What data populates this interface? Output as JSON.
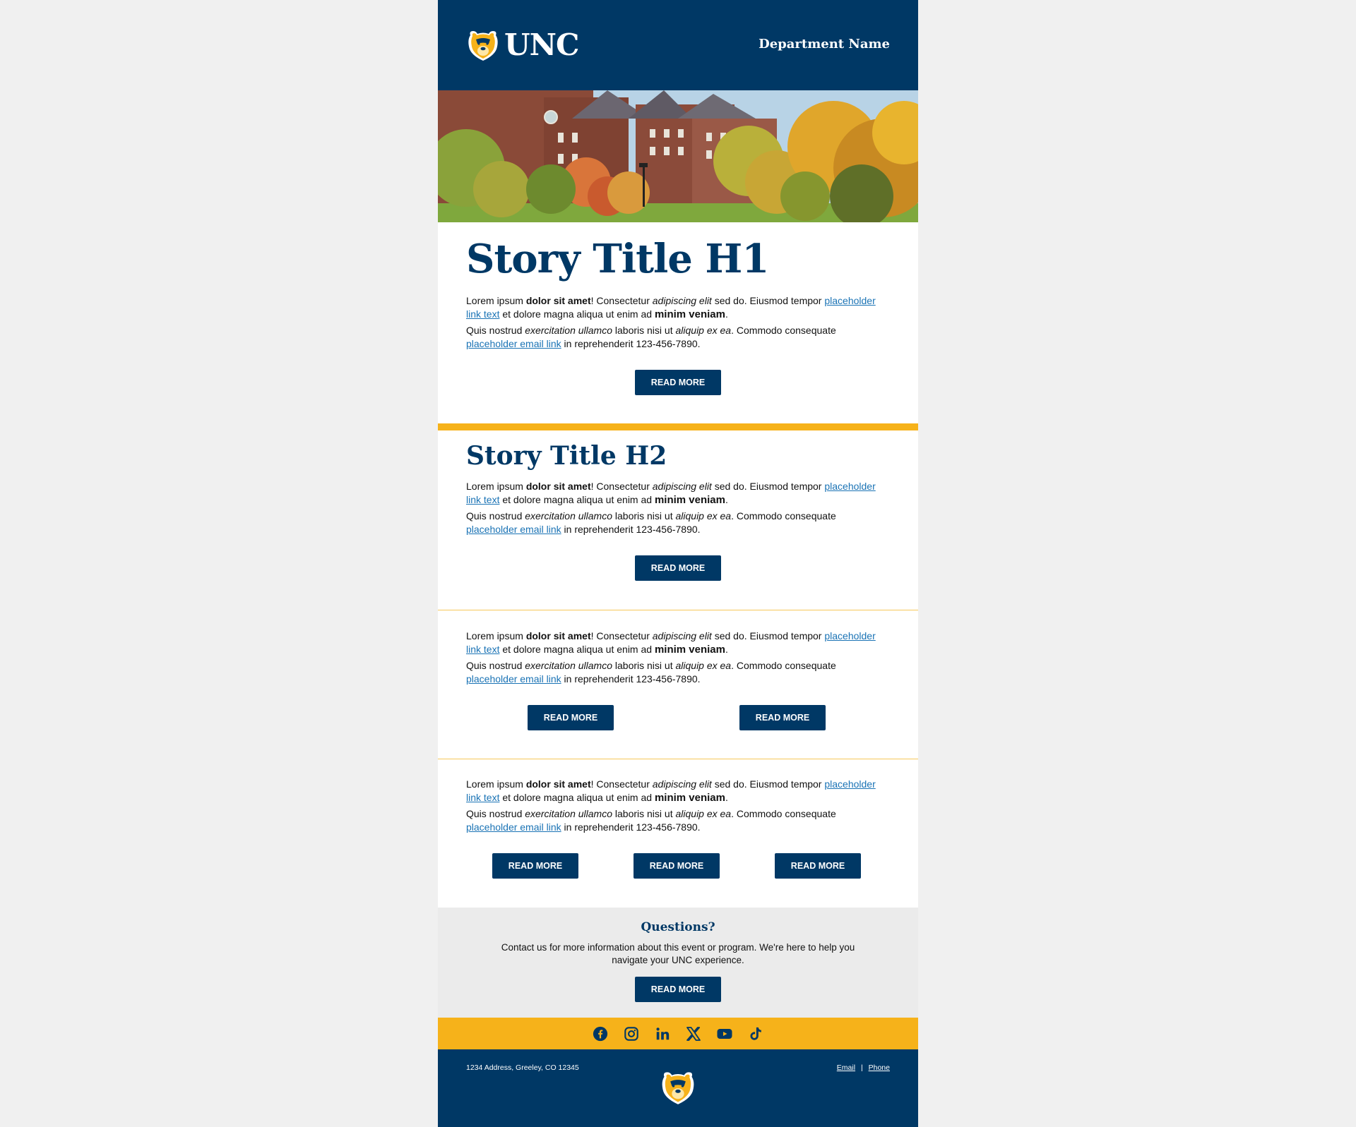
{
  "header": {
    "logo_text": "UNC",
    "department": "Department Name"
  },
  "story1": {
    "title": "Story Title H1",
    "button": "READ MORE"
  },
  "story2": {
    "title": "Story Title H2",
    "button": "READ MORE"
  },
  "body_text": {
    "p1_a": "Lorem ipsum ",
    "p1_b": "dolor sit amet",
    "p1_c": "! Consectetur ",
    "p1_d": "adipiscing elit",
    "p1_e": " sed do. Eiusmod tempor ",
    "p1_link": "placeholder link text",
    "p1_f": " et dolore magna aliqua ut enim ad ",
    "p1_g": "minim veniam",
    "p1_h": ".",
    "p2_a": "Quis nostrud ",
    "p2_b": "exercitation ullamco",
    "p2_c": " laboris nisi ut ",
    "p2_d": "aliquip ex ea",
    "p2_e": ". Commodo consequate ",
    "p2_link": "placeholder email link",
    "p2_f": " in reprehenderit 123-456-7890."
  },
  "section3": {
    "buttons": [
      "READ MORE",
      "READ MORE"
    ]
  },
  "section4": {
    "buttons": [
      "READ MORE",
      "READ MORE",
      "READ MORE"
    ]
  },
  "questions": {
    "title": "Questions?",
    "text": "Contact us for more information about this event or program. We're here to help you navigate your UNC experience.",
    "button": "READ MORE"
  },
  "social": {
    "icons": [
      "facebook-icon",
      "instagram-icon",
      "linkedin-icon",
      "x-icon",
      "youtube-icon",
      "tiktok-icon"
    ]
  },
  "footer": {
    "address": "1234 Address, Greeley, CO 12345",
    "email": "Email",
    "separator": "|",
    "phone": "Phone"
  },
  "colors": {
    "navy": "#003865",
    "gold": "#f6b21a",
    "link": "#1a73b5",
    "light_gray": "#ebebeb"
  }
}
